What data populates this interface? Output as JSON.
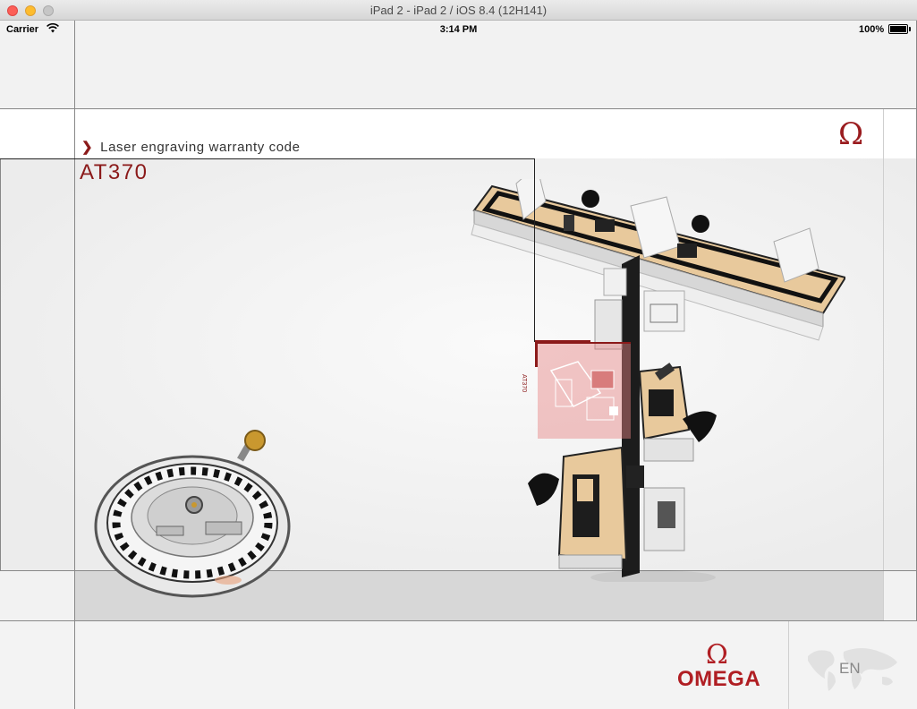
{
  "window": {
    "title": "iPad 2 - iPad 2 / iOS 8.4 (12H141)"
  },
  "status_bar": {
    "carrier": "Carrier",
    "time": "3:14 PM",
    "battery": "100%"
  },
  "header": {
    "breadcrumb": "Laser engraving warranty code",
    "omega_symbol": "Ω"
  },
  "station": {
    "code": "AT370",
    "tag": "AT370"
  },
  "footer": {
    "brand_symbol": "Ω",
    "brand_name": "OMEGA",
    "language": "EN"
  },
  "colors": {
    "accent": "#8b1a1a",
    "brand": "#b01e23",
    "highlight": "#e68282"
  },
  "icons": [
    "wifi-icon",
    "battery-icon",
    "chevron-right-icon",
    "omega-icon",
    "world-map-icon"
  ]
}
